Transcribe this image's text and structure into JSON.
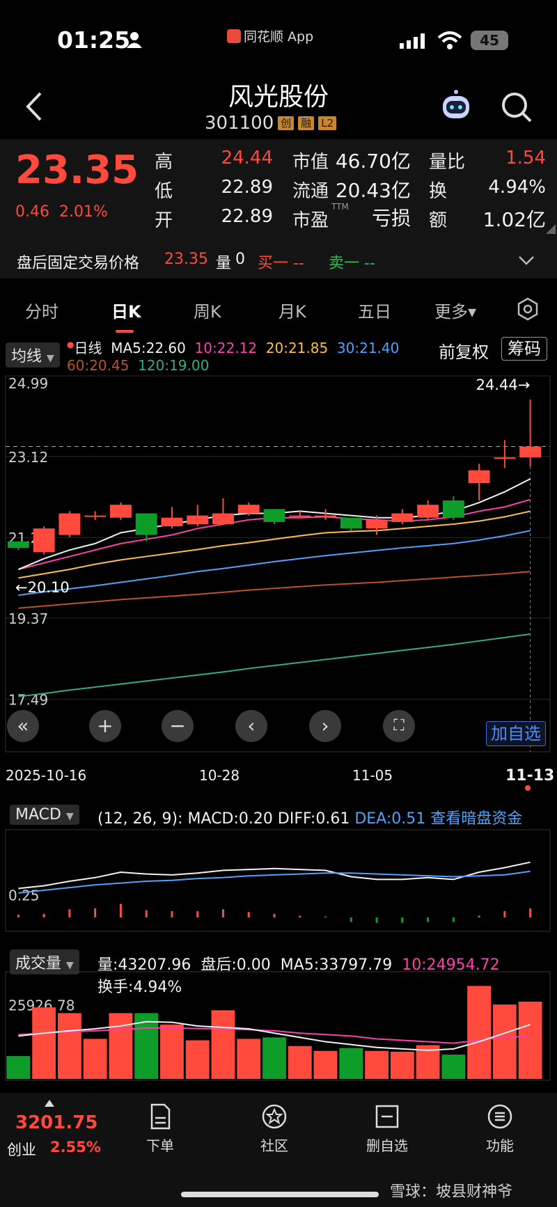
{
  "status": {
    "time": "01:25",
    "app_name": "同花顺 App",
    "battery": "45"
  },
  "header": {
    "name": "风光股份",
    "code": "301100",
    "tags": [
      "创",
      "融",
      "L2"
    ]
  },
  "quote": {
    "price": "23.35",
    "change": "0.46",
    "change_pct": "2.01%",
    "high_label": "高",
    "high": "24.44",
    "low_label": "低",
    "low": "22.89",
    "open_label": "开",
    "open": "22.89",
    "mcap_label": "市值",
    "mcap": "46.70亿",
    "float_label": "流通",
    "float": "20.43亿",
    "pe_label": "市盈",
    "pe_sup": "TTM",
    "pe": "亏损",
    "vr_label": "量比",
    "vr": "1.54",
    "turn_label": "换",
    "turn": "4.94%",
    "amt_label": "额",
    "amt": "1.02亿"
  },
  "after_hours": {
    "label": "盘后固定交易价格",
    "price": "23.35",
    "vol_label": "量",
    "vol": "0",
    "buy": "买一 --",
    "sell": "卖一 --"
  },
  "tabs": [
    "分时",
    "日K",
    "周K",
    "月K",
    "五日",
    "更多▾"
  ],
  "kline": {
    "ma_selector": "均线",
    "ma_header": {
      "daily": "日线",
      "ma5": "MA5:22.60",
      "ma10": "10:22.12",
      "ma20": "20:21.85",
      "ma30": "30:21.40",
      "ma60": "60:20.45",
      "ma120": "120:19.00"
    },
    "adjust": "前复权",
    "chips": "筹码",
    "y_labels": [
      "24.99",
      "23.12",
      "21.24",
      "19.37",
      "17.49"
    ],
    "max_label": "24.44→",
    "min_label": "←20.10",
    "add_watch": "加自选",
    "x_labels": [
      "2025-10-16",
      "10-28",
      "11-05",
      "11-13"
    ]
  },
  "macd": {
    "selector": "MACD",
    "params": "(12, 26, 9):",
    "macd": "MACD:0.20",
    "diff": "DIFF:0.61",
    "dea": "DEA:0.51",
    "link": "查看暗盘资金",
    "y_label": "0.25"
  },
  "volume": {
    "selector": "成交量",
    "vol": "量:43207.96",
    "after": "盘后:0.00",
    "ma5": "MA5:33797.79",
    "ma10": "10:24954.72",
    "turnover": "换手:4.94%",
    "y_label": "25926.78"
  },
  "bottom": {
    "index_value": "3201.75",
    "index_name": "创业",
    "index_pct": "2.55%",
    "nav": [
      "下单",
      "社区",
      "删自选",
      "功能"
    ]
  },
  "watermark": "雪球：坡县财神爷",
  "chart_data": [
    {
      "type": "candlestick",
      "title": "日K",
      "x": [
        "2025-10-16",
        "",
        "",
        "",
        "",
        "",
        "",
        "10-28",
        "",
        "",
        "",
        "",
        "",
        "11-05",
        "",
        "",
        "",
        "",
        "",
        "",
        "11-13"
      ],
      "open": [
        21.15,
        20.9,
        21.3,
        21.75,
        21.7,
        21.8,
        21.5,
        21.55,
        21.55,
        21.8,
        21.9,
        21.75,
        21.75,
        21.7,
        21.45,
        21.6,
        21.7,
        22.1,
        22.5,
        23.1,
        23.1
      ],
      "close": [
        21.0,
        21.45,
        21.8,
        21.75,
        22.0,
        21.3,
        21.7,
        21.75,
        21.8,
        22.0,
        21.6,
        21.75,
        21.75,
        21.45,
        21.65,
        21.8,
        22.0,
        21.7,
        22.8,
        23.1,
        23.35
      ],
      "high": [
        21.1,
        21.5,
        21.85,
        21.85,
        22.05,
        21.8,
        21.95,
        22.0,
        22.15,
        22.05,
        21.9,
        21.85,
        21.9,
        21.55,
        21.75,
        21.9,
        22.1,
        22.2,
        22.95,
        23.5,
        24.44
      ],
      "low": [
        20.95,
        20.85,
        21.25,
        21.65,
        21.65,
        21.15,
        21.45,
        21.5,
        21.65,
        21.75,
        21.55,
        21.7,
        21.65,
        21.4,
        21.3,
        21.55,
        21.65,
        21.65,
        22.1,
        22.85,
        22.89
      ],
      "ma5": [
        20.5,
        20.75,
        20.95,
        21.1,
        21.35,
        21.45,
        21.55,
        21.65,
        21.75,
        21.8,
        21.8,
        21.85,
        21.8,
        21.75,
        21.7,
        21.7,
        21.75,
        21.85,
        22.05,
        22.3,
        22.6
      ],
      "ma10": [
        20.5,
        20.65,
        20.8,
        20.95,
        21.1,
        21.2,
        21.3,
        21.45,
        21.55,
        21.65,
        21.7,
        21.7,
        21.72,
        21.68,
        21.65,
        21.62,
        21.65,
        21.72,
        21.85,
        21.95,
        22.12
      ],
      "ma20": [
        20.3,
        20.4,
        20.5,
        20.62,
        20.72,
        20.8,
        20.88,
        20.96,
        21.05,
        21.12,
        21.2,
        21.28,
        21.35,
        21.38,
        21.4,
        21.45,
        21.5,
        21.55,
        21.62,
        21.72,
        21.85
      ],
      "ma30": [
        19.9,
        19.98,
        20.05,
        20.12,
        20.2,
        20.28,
        20.36,
        20.45,
        20.52,
        20.6,
        20.68,
        20.75,
        20.82,
        20.88,
        20.94,
        21.0,
        21.05,
        21.1,
        21.18,
        21.28,
        21.4
      ],
      "ma60": [
        19.6,
        19.65,
        19.7,
        19.75,
        19.8,
        19.84,
        19.88,
        19.92,
        19.97,
        20.02,
        20.06,
        20.1,
        20.14,
        20.17,
        20.2,
        20.24,
        20.28,
        20.32,
        20.36,
        20.4,
        20.45
      ],
      "ma120": [
        17.55,
        17.62,
        17.7,
        17.77,
        17.84,
        17.91,
        17.98,
        18.05,
        18.12,
        18.2,
        18.27,
        18.34,
        18.41,
        18.48,
        18.55,
        18.62,
        18.69,
        18.76,
        18.84,
        18.92,
        19.0
      ],
      "ylim": [
        17.49,
        24.99
      ]
    },
    {
      "type": "bar",
      "title": "MACD",
      "values": [
        0.03,
        0.04,
        0.09,
        0.1,
        0.15,
        0.08,
        0.07,
        0.07,
        0.09,
        0.06,
        0.04,
        0.02,
        0.01,
        -0.05,
        -0.06,
        -0.06,
        -0.05,
        -0.05,
        0.02,
        0.07,
        0.1
      ],
      "diff": [
        0.32,
        0.35,
        0.4,
        0.44,
        0.5,
        0.48,
        0.47,
        0.49,
        0.52,
        0.53,
        0.54,
        0.53,
        0.52,
        0.45,
        0.42,
        0.42,
        0.44,
        0.42,
        0.5,
        0.55,
        0.61
      ],
      "dea": [
        0.27,
        0.3,
        0.33,
        0.36,
        0.38,
        0.4,
        0.41,
        0.43,
        0.44,
        0.46,
        0.47,
        0.48,
        0.49,
        0.49,
        0.48,
        0.47,
        0.46,
        0.45,
        0.46,
        0.47,
        0.51
      ]
    },
    {
      "type": "bar",
      "title": "成交量",
      "values": [
        8000,
        25000,
        23000,
        14000,
        23000,
        23000,
        19000,
        13500,
        24000,
        14000,
        14500,
        11500,
        9800,
        10800,
        9800,
        9500,
        11800,
        8500,
        32500,
        26000,
        27000
      ],
      "ma5": [
        15000,
        16000,
        16800,
        17500,
        18500,
        20000,
        19800,
        18500,
        18000,
        17500,
        16000,
        14500,
        13000,
        12000,
        11000,
        10500,
        10000,
        10500,
        13000,
        16000,
        19000
      ],
      "ma10": [
        15500,
        16000,
        16500,
        16800,
        17200,
        17800,
        17800,
        17600,
        17500,
        17200,
        16800,
        16000,
        15500,
        15000,
        14000,
        13500,
        13000,
        12500,
        13500,
        14500,
        15000
      ],
      "ylabel_ref": 25926.78
    }
  ]
}
